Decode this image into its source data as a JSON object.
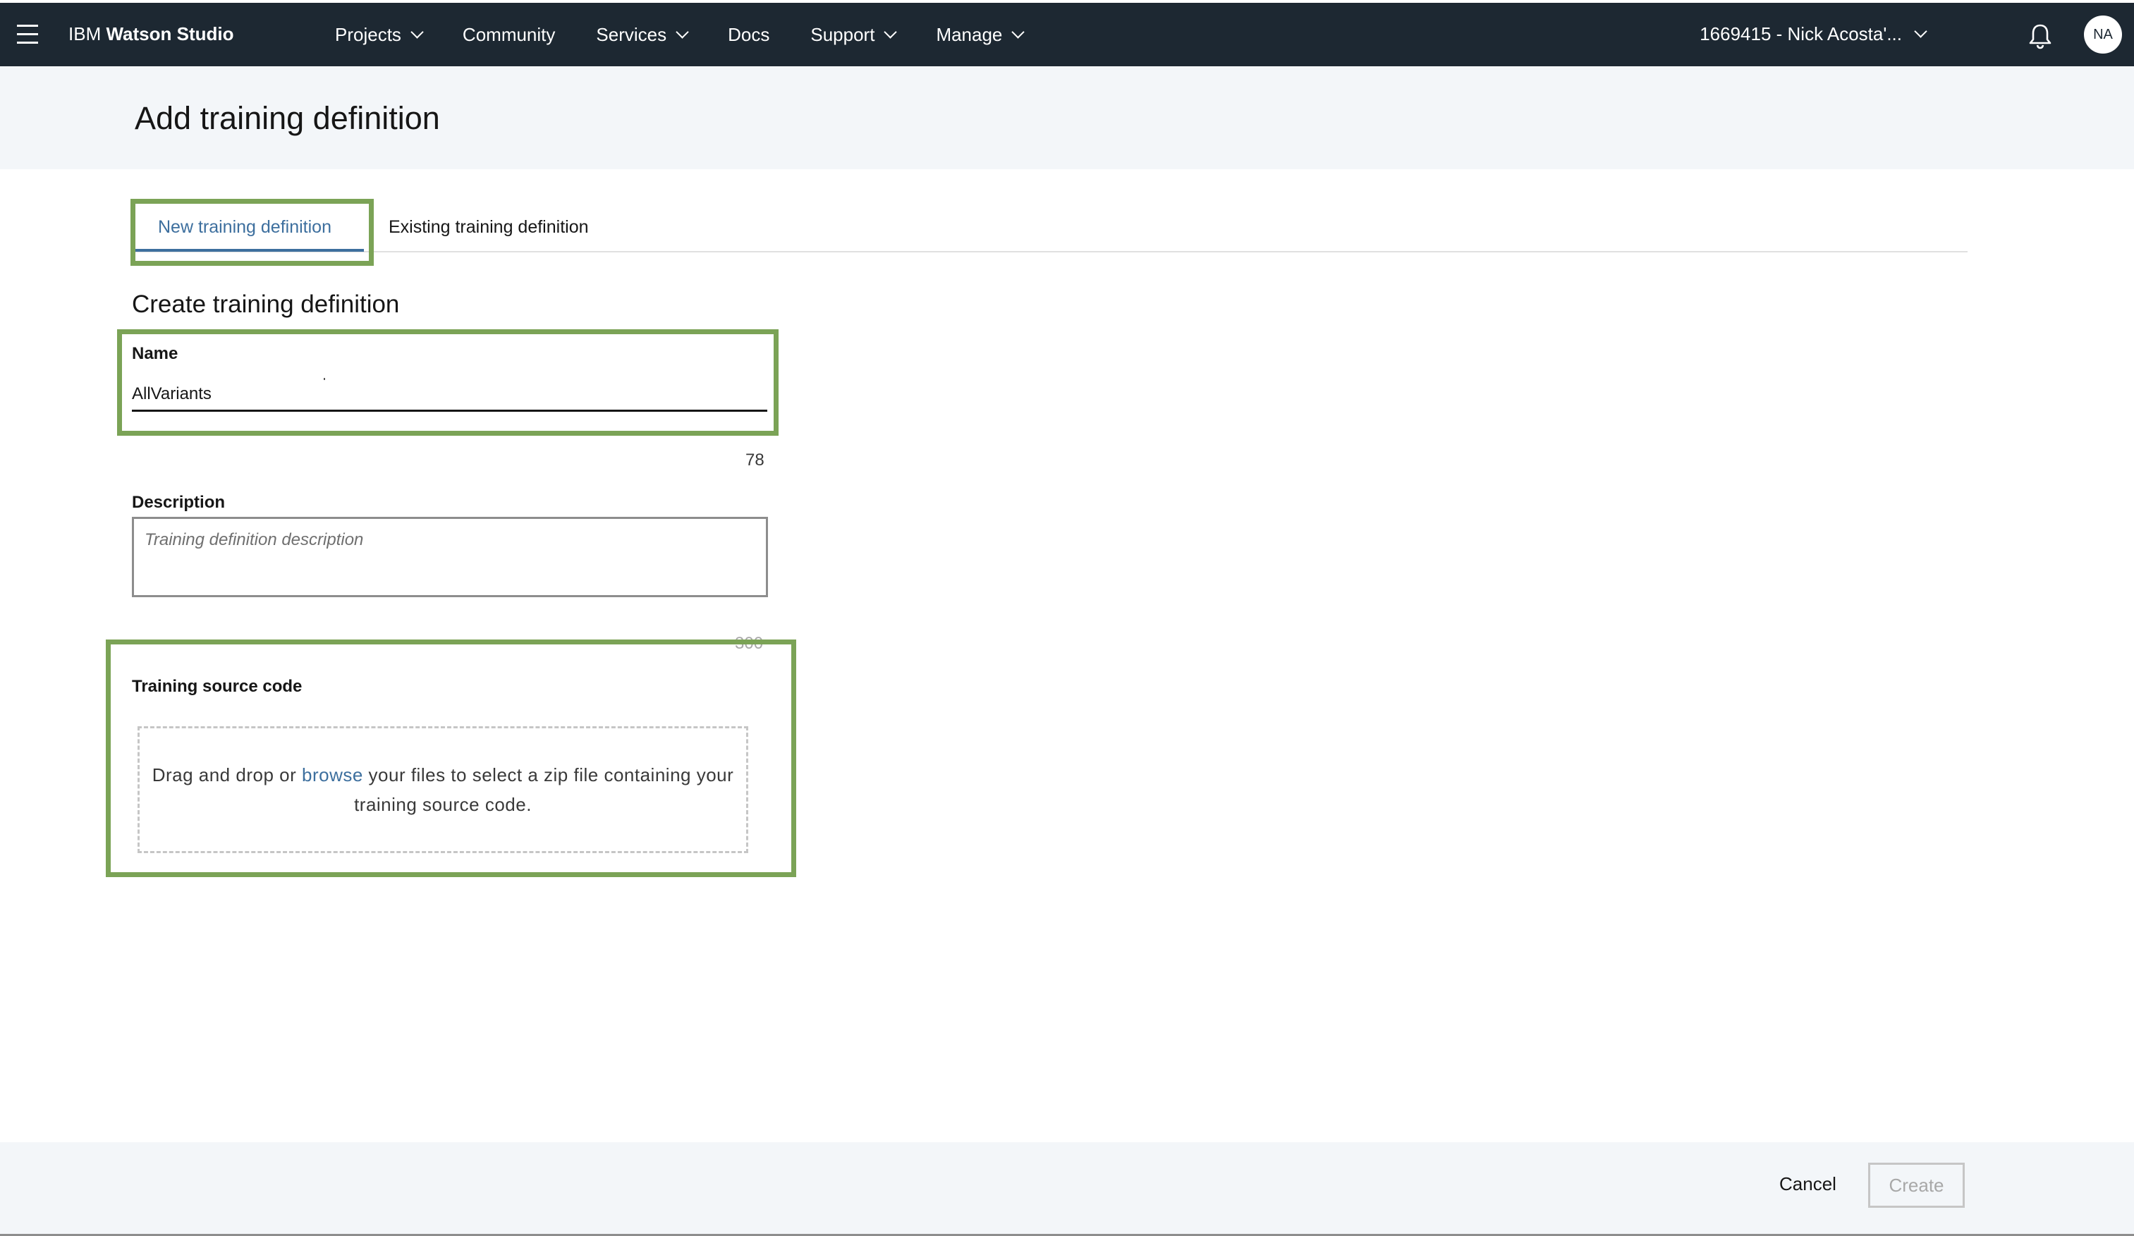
{
  "topbar": {
    "brand_prefix": "IBM",
    "brand_name": "Watson Studio",
    "nav": [
      {
        "label": "Projects",
        "has_dropdown": true
      },
      {
        "label": "Community",
        "has_dropdown": false
      },
      {
        "label": "Services",
        "has_dropdown": true
      },
      {
        "label": "Docs",
        "has_dropdown": false
      },
      {
        "label": "Support",
        "has_dropdown": true
      },
      {
        "label": "Manage",
        "has_dropdown": true
      }
    ],
    "account": "1669415 - Nick Acosta'...",
    "avatar_initials": "NA",
    "icons": {
      "menu": "hamburger-icon",
      "notifications": "bell-icon",
      "dropdown": "chevron-down-icon"
    }
  },
  "page": {
    "title": "Add training definition"
  },
  "tabs": [
    {
      "label": "New training definition",
      "selected": true
    },
    {
      "label": "Existing training definition",
      "selected": false
    }
  ],
  "form": {
    "section_title": "Create training definition",
    "name": {
      "label": "Name",
      "value": "AllVariants",
      "remaining": "78"
    },
    "description": {
      "label": "Description",
      "placeholder": "Training definition description",
      "remaining": "300"
    },
    "source_code": {
      "label": "Training source code",
      "dropzone_before": "Drag and drop or ",
      "dropzone_link": "browse",
      "dropzone_after": " your files to select a zip file containing your training source code."
    }
  },
  "footer": {
    "cancel_label": "Cancel",
    "create_label": "Create",
    "create_enabled": false
  },
  "colors": {
    "topbar_bg": "#1d2832",
    "band_bg": "#f3f6f9",
    "link": "#3d6f9e",
    "highlight": "#7ba356"
  }
}
